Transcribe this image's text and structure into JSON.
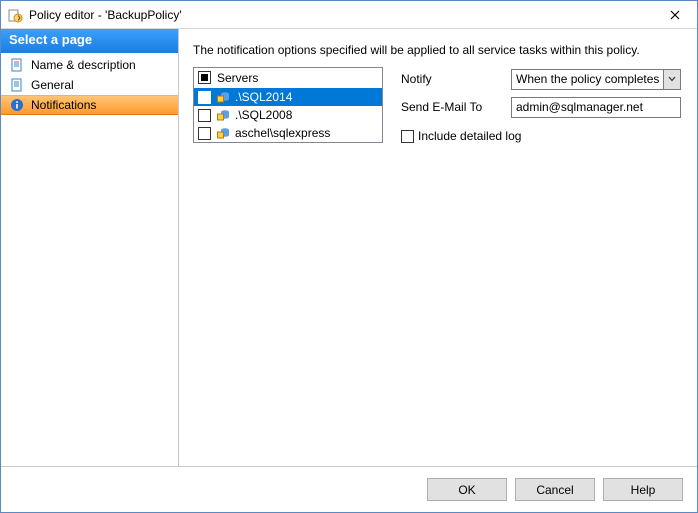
{
  "window": {
    "title": "Policy editor - 'BackupPolicy'"
  },
  "sidebar": {
    "header": "Select a page",
    "items": [
      {
        "label": "Name & description"
      },
      {
        "label": "General"
      },
      {
        "label": "Notifications"
      }
    ]
  },
  "content": {
    "hint": "The notification options specified will be applied to all service tasks within this policy.",
    "servers_header": "Servers",
    "servers": [
      {
        "name": ".\\SQL2014",
        "checked": true
      },
      {
        "name": ".\\SQL2008",
        "checked": false
      },
      {
        "name": "aschel\\sqlexpress",
        "checked": false
      }
    ],
    "form": {
      "notify_label": "Notify",
      "notify_value": "When the policy completes",
      "email_label": "Send E-Mail To",
      "email_value": "admin@sqlmanager.net",
      "include_log_label": "Include detailed log"
    }
  },
  "footer": {
    "ok": "OK",
    "cancel": "Cancel",
    "help": "Help"
  }
}
